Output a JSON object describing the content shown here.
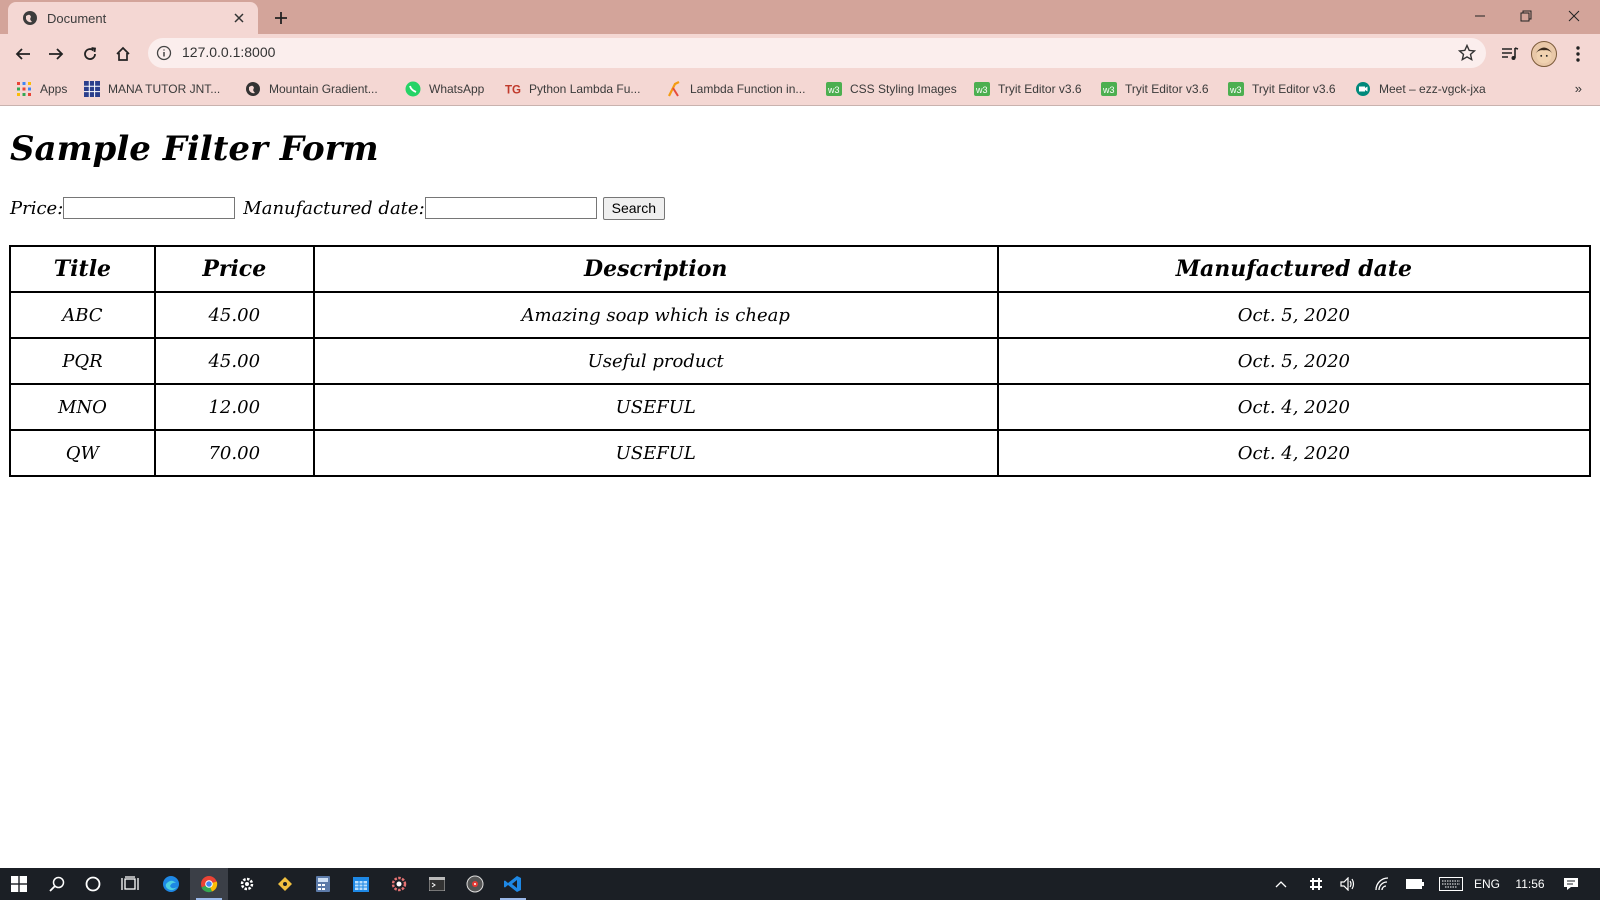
{
  "browser": {
    "tab_title": "Document",
    "url": "127.0.0.1:8000",
    "bookmarks": [
      {
        "label": "Apps",
        "icon": "apps-grid-icon"
      },
      {
        "label": "MANA TUTOR JNT...",
        "icon": "grid-favicon"
      },
      {
        "label": "Mountain Gradient...",
        "icon": "globe-icon"
      },
      {
        "label": "WhatsApp",
        "icon": "whatsapp-icon"
      },
      {
        "label": "Python Lambda Fu...",
        "icon": "tg-logo"
      },
      {
        "label": "Lambda Function in...",
        "icon": "lambda-icon"
      },
      {
        "label": "CSS Styling Images",
        "icon": "w3-icon"
      },
      {
        "label": "Tryit Editor v3.6",
        "icon": "w3-icon"
      },
      {
        "label": "Tryit Editor v3.6",
        "icon": "w3-icon"
      },
      {
        "label": "Tryit Editor v3.6",
        "icon": "w3-icon"
      },
      {
        "label": "Meet – ezz-vgck-jxa",
        "icon": "meet-icon"
      }
    ],
    "more_label": "»"
  },
  "page": {
    "title": "Sample Filter Form",
    "filter": {
      "price_label": "Price:",
      "price_value": "",
      "date_label": "Manufactured date:",
      "date_value": "",
      "search_label": "Search"
    },
    "table": {
      "headers": [
        "Title",
        "Price",
        "Description",
        "Manufactured date"
      ],
      "rows": [
        [
          "ABC",
          "45.00",
          "Amazing soap which is cheap",
          "Oct. 5, 2020"
        ],
        [
          "PQR",
          "45.00",
          "Useful product",
          "Oct. 5, 2020"
        ],
        [
          "MNO",
          "12.00",
          "USEFUL",
          "Oct. 4, 2020"
        ],
        [
          "QW",
          "70.00",
          "USEFUL",
          "Oct. 4, 2020"
        ]
      ]
    }
  },
  "taskbar": {
    "language": "ENG",
    "time": "11:56"
  },
  "colors": {
    "tab_strip": "#d3a49a",
    "toolbar": "#f4d7d3",
    "taskbar": "#1b1f25"
  }
}
